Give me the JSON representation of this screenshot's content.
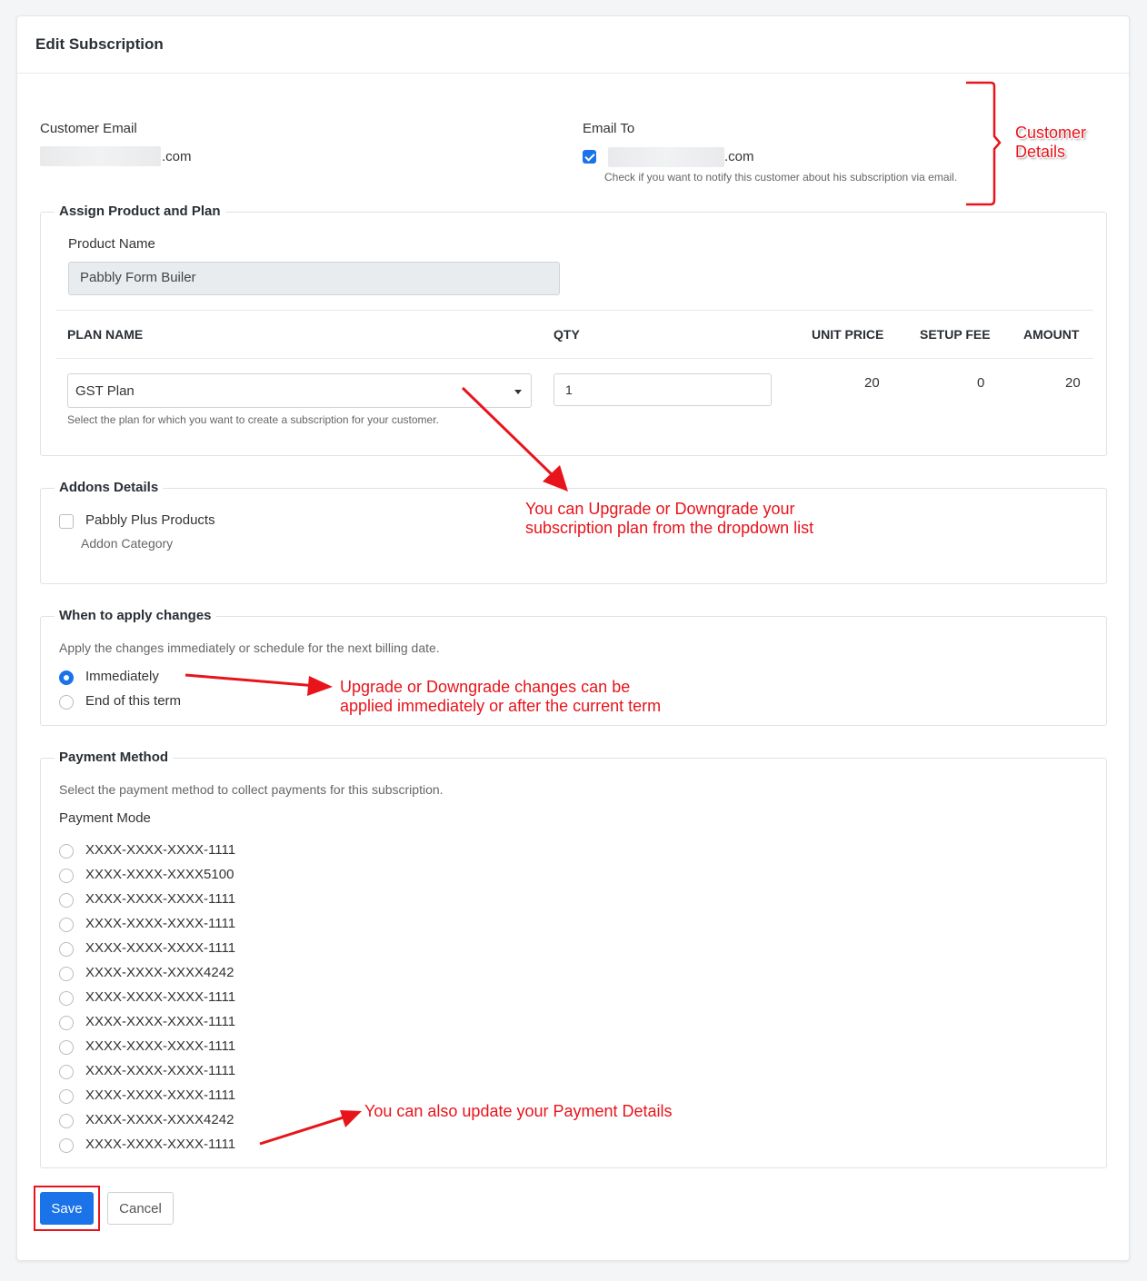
{
  "page": {
    "title": "Edit Subscription"
  },
  "customer": {
    "email_label": "Customer Email",
    "email_suffix": ".com",
    "email_to_label": "Email To",
    "email_to_suffix": ".com",
    "email_to_checked": true,
    "email_to_help": "Check if you want to notify this customer about his subscription via email."
  },
  "product_plan": {
    "legend": "Assign Product and Plan",
    "product_name_label": "Product Name",
    "product_name_value": "Pabbly Form Builer",
    "columns": [
      "PLAN NAME",
      "QTY",
      "UNIT PRICE",
      "SETUP FEE",
      "AMOUNT"
    ],
    "plan_selected": "GST Plan",
    "qty": "1",
    "unit_price": "20",
    "setup_fee": "0",
    "amount": "20",
    "plan_help": "Select the plan for which you want to create a subscription for your customer."
  },
  "addons": {
    "legend": "Addons Details",
    "item_label": "Pabbly Plus Products",
    "item_checked": false,
    "item_category": "Addon Category"
  },
  "apply_changes": {
    "legend": "When to apply changes",
    "description": "Apply the changes immediately or schedule for the next billing date.",
    "options": [
      {
        "label": "Immediately",
        "selected": true
      },
      {
        "label": "End of this term",
        "selected": false
      }
    ]
  },
  "payment": {
    "legend": "Payment Method",
    "description": "Select the payment method to collect payments for this subscription.",
    "mode_label": "Payment Mode",
    "cards": [
      "XXXX-XXXX-XXXX-1111",
      "XXXX-XXXX-XXXX5100",
      "XXXX-XXXX-XXXX-1111",
      "XXXX-XXXX-XXXX-1111",
      "XXXX-XXXX-XXXX-1111",
      "XXXX-XXXX-XXXX4242",
      "XXXX-XXXX-XXXX-1111",
      "XXXX-XXXX-XXXX-1111",
      "XXXX-XXXX-XXXX-1111",
      "XXXX-XXXX-XXXX-1111",
      "XXXX-XXXX-XXXX-1111",
      "XXXX-XXXX-XXXX4242",
      "XXXX-XXXX-XXXX-1111"
    ]
  },
  "actions": {
    "save_label": "Save",
    "cancel_label": "Cancel"
  },
  "annotations": {
    "customer_details_line1": "Customer",
    "customer_details_line2": "Details",
    "plan_line1": "You can Upgrade or Downgrade your",
    "plan_line2": "subscription plan from the dropdown list",
    "apply_line1": "Upgrade or Downgrade changes can be",
    "apply_line2": "applied immediately or after the current term",
    "payment_line1": "You can also update your Payment Details"
  },
  "colors": {
    "accent": "#1a73e8",
    "annotation": "#e8141b"
  }
}
